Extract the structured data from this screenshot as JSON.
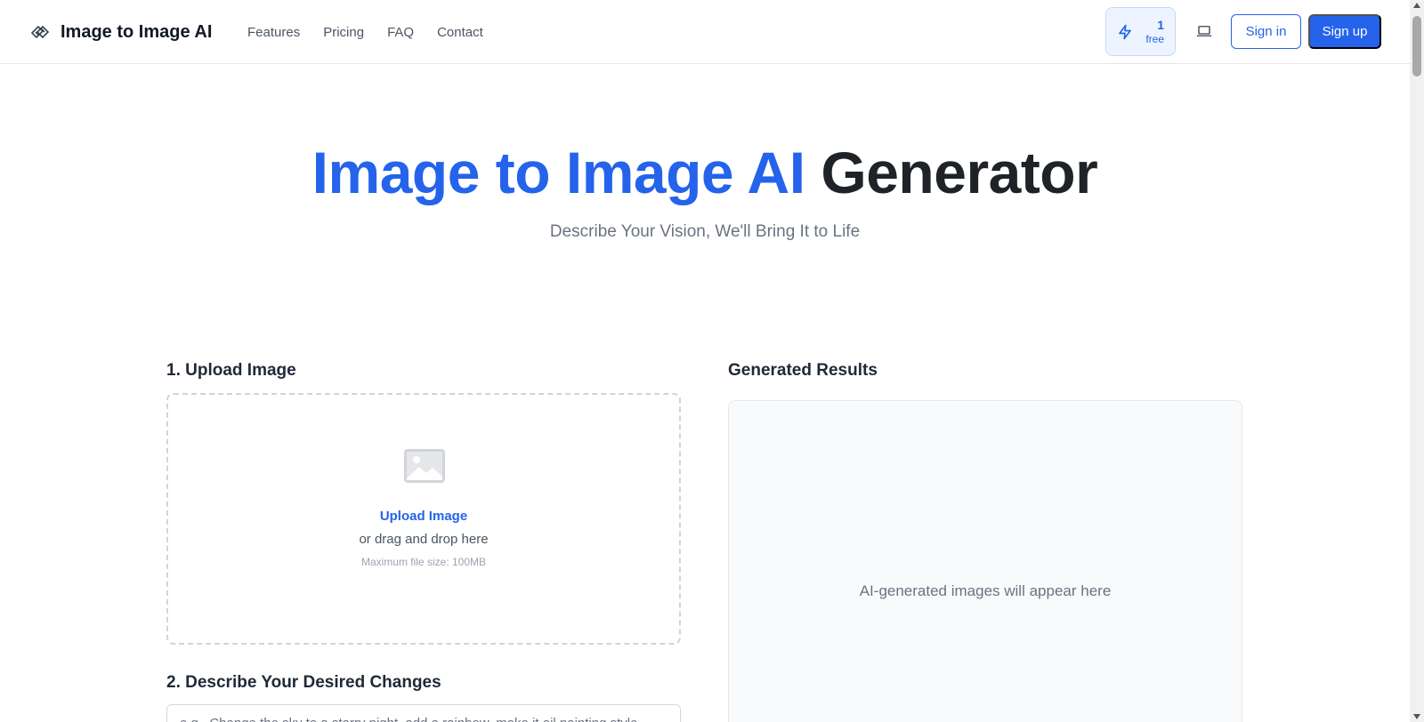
{
  "header": {
    "brand_name": "Image to Image AI",
    "nav": [
      {
        "label": "Features"
      },
      {
        "label": "Pricing"
      },
      {
        "label": "FAQ"
      },
      {
        "label": "Contact"
      }
    ],
    "credits": {
      "count": "1",
      "label": "free"
    },
    "sign_in": "Sign in",
    "sign_up": "Sign up"
  },
  "hero": {
    "title_highlight": "Image to Image AI",
    "title_rest": "Generator",
    "subtitle": "Describe Your Vision, We'll Bring It to Life"
  },
  "upload": {
    "section_label": "1. Upload Image",
    "cta": "Upload Image",
    "drag_text": "or drag and drop here",
    "max_size": "Maximum file size: 100MB"
  },
  "results": {
    "section_label": "Generated Results",
    "empty_text": "AI-generated images will appear here"
  },
  "describe": {
    "section_label": "2. Describe Your Desired Changes",
    "placeholder": "e.g., Change the sky to a starry night, add a rainbow, make it oil painting style"
  },
  "colors": {
    "accent": "#2563eb",
    "heading": "#1f2328",
    "muted": "#6b7280"
  },
  "icons": {
    "brand": "layers-diamond-icon",
    "credits": "lightning-bolt-icon",
    "theme": "laptop-icon",
    "upload": "image-placeholder-icon"
  }
}
